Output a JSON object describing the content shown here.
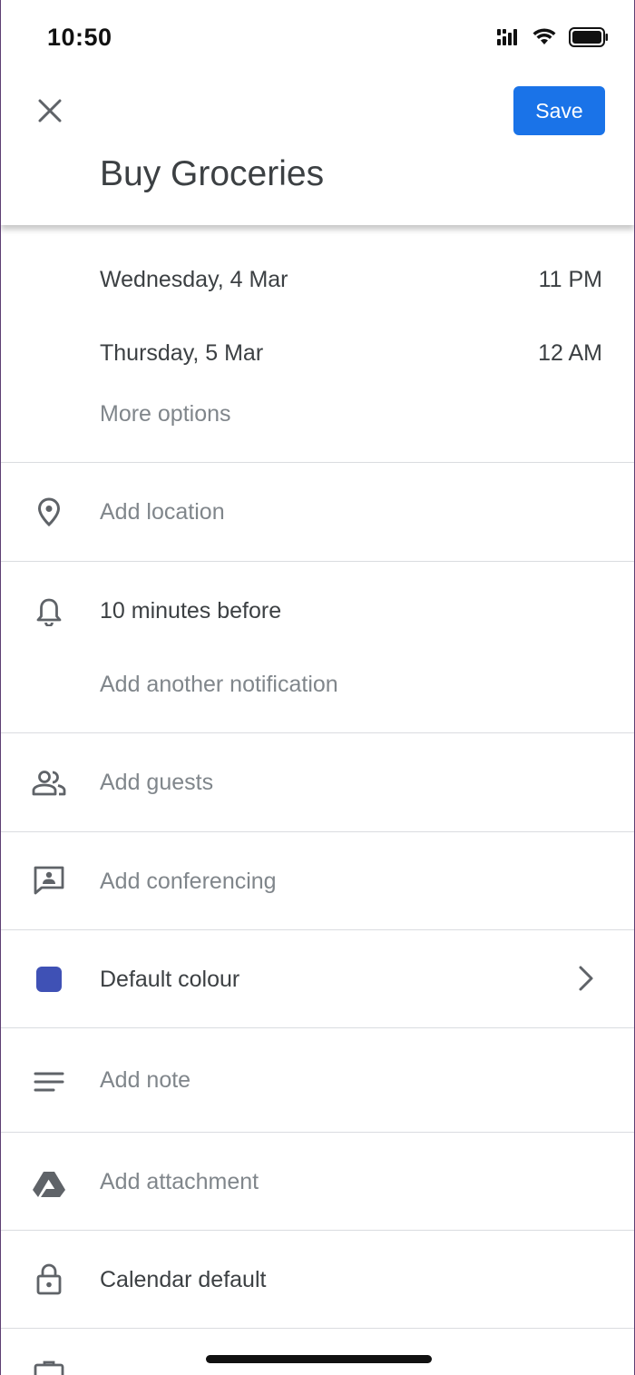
{
  "status_bar": {
    "time": "10:50"
  },
  "header": {
    "title": "Buy Groceries",
    "save_label": "Save"
  },
  "dates": [
    {
      "date": "Wednesday, 4 Mar",
      "time": "11 PM"
    },
    {
      "date": "Thursday, 5 Mar",
      "time": "12 AM"
    }
  ],
  "more_options": "More options",
  "rows": {
    "location": "Add location",
    "notification": "10 minutes before",
    "add_notification": "Add another notification",
    "guests": "Add guests",
    "conferencing": "Add conferencing",
    "colour": "Default colour",
    "note": "Add note",
    "attachment": "Add attachment",
    "visibility": "Calendar default"
  },
  "colors": {
    "accent": "#1a73e8",
    "event_colour": "#3f51b5"
  }
}
